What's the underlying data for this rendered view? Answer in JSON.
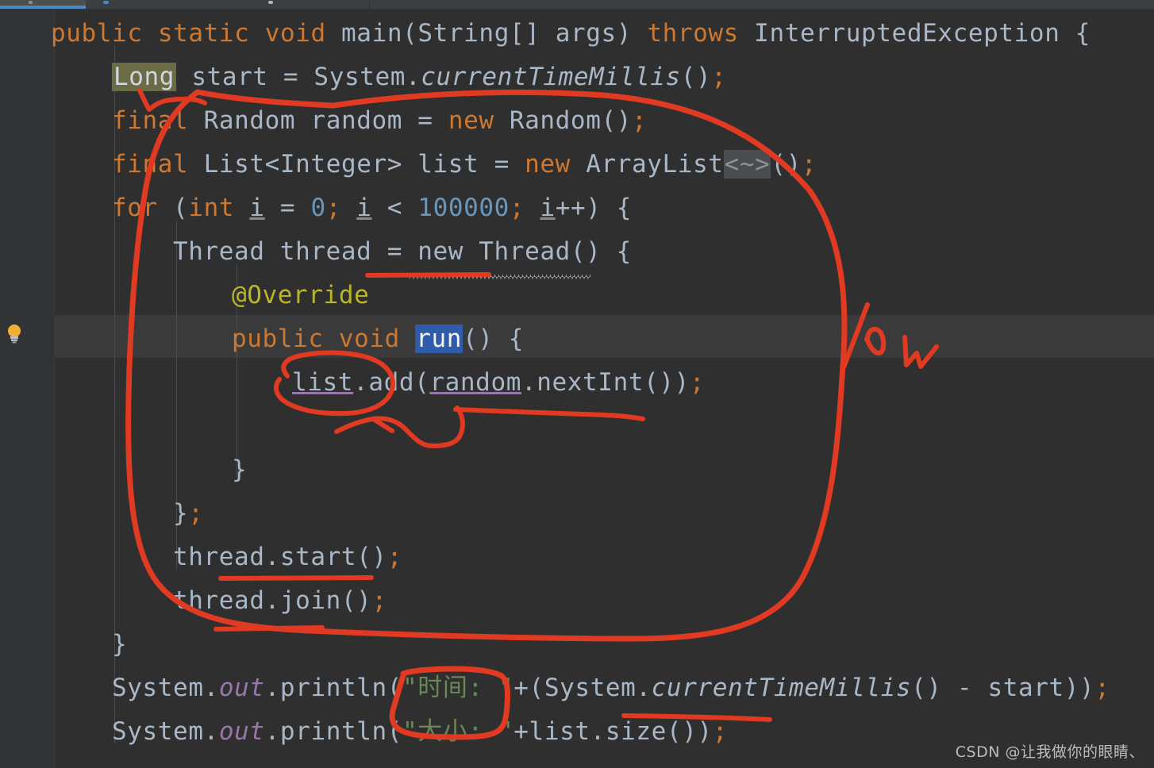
{
  "app": {
    "theme_background": "#2f2f2f",
    "gutter_background": "#313335",
    "caret_line_background": "#3a3a3a",
    "ink_color": "#e03a22",
    "accent_tab": "#4a88c7"
  },
  "tabbar": {
    "active_tab_indicator_color": "#4a88c7",
    "background": "#3c3f41"
  },
  "gutter": {
    "intention_icon": "lightbulb-icon"
  },
  "editor": {
    "language": "java",
    "selected_token": "run",
    "highlighted_identifier": "Long",
    "inferred_type_hint": "<~>",
    "caret_line_index": 7,
    "lines": [
      {
        "index": 0,
        "indent": 0,
        "segments": [
          {
            "text": "public",
            "cls": "kw"
          },
          {
            "text": " ",
            "cls": "plain"
          },
          {
            "text": "static",
            "cls": "kw"
          },
          {
            "text": " ",
            "cls": "plain"
          },
          {
            "text": "void",
            "cls": "kw"
          },
          {
            "text": " ",
            "cls": "plain"
          },
          {
            "text": "main",
            "cls": "plain"
          },
          {
            "text": "(String[] args) ",
            "cls": "plain"
          },
          {
            "text": "throws",
            "cls": "kw"
          },
          {
            "text": " InterruptedException {",
            "cls": "plain"
          }
        ],
        "plain": "public static void main(String[] args) throws InterruptedException {"
      },
      {
        "index": 1,
        "indent": 1,
        "plain": "Long start = System.currentTimeMillis();"
      },
      {
        "index": 2,
        "indent": 1,
        "plain": "final Random random = new Random();"
      },
      {
        "index": 3,
        "indent": 1,
        "plain": "final List<Integer> list = new ArrayList<~>();"
      },
      {
        "index": 4,
        "indent": 1,
        "plain": "for (int i = 0; i < 100000; i++) {"
      },
      {
        "index": 5,
        "indent": 2,
        "plain": "Thread thread = new Thread() {"
      },
      {
        "index": 6,
        "indent": 3,
        "plain": "@Override"
      },
      {
        "index": 7,
        "indent": 3,
        "plain": "public void run() {"
      },
      {
        "index": 8,
        "indent": 4,
        "plain": "list.add(random.nextInt());"
      },
      {
        "index": 9,
        "indent": 0,
        "plain": ""
      },
      {
        "index": 10,
        "indent": 3,
        "plain": "}"
      },
      {
        "index": 11,
        "indent": 2,
        "plain": "};"
      },
      {
        "index": 12,
        "indent": 2,
        "plain": "thread.start();"
      },
      {
        "index": 13,
        "indent": 2,
        "plain": "thread.join();"
      },
      {
        "index": 14,
        "indent": 1,
        "plain": "}"
      },
      {
        "index": 15,
        "indent": 1,
        "plain": "System.out.println(\"时间: \"+(System.currentTimeMillis() - start));"
      },
      {
        "index": 16,
        "indent": 1,
        "plain": "System.out.println(\"大小: \"+list.size());"
      }
    ],
    "strings": {
      "time_label": "时间: ",
      "size_label": "大小: "
    },
    "warnings": [
      {
        "token": "new Thread()",
        "style": "wavy-underline"
      }
    ]
  },
  "annotations": {
    "description": "hand-drawn red pen marks",
    "marks": [
      {
        "name": "big-loop-circle",
        "kind": "circle"
      },
      {
        "name": "list-add-circle",
        "kind": "circle"
      },
      {
        "name": "new-thread-underline",
        "kind": "underline"
      },
      {
        "name": "thread-start-underline",
        "kind": "underline"
      },
      {
        "name": "thread-join-underline",
        "kind": "underline"
      },
      {
        "name": "list-add-arrow",
        "kind": "arrow"
      },
      {
        "name": "time-label-circle",
        "kind": "circle"
      },
      {
        "name": "current-time-millis-underline",
        "kind": "underline"
      },
      {
        "name": "tick-mark",
        "kind": "check"
      }
    ]
  },
  "watermark": {
    "text": "CSDN @让我做你的眼睛、"
  }
}
